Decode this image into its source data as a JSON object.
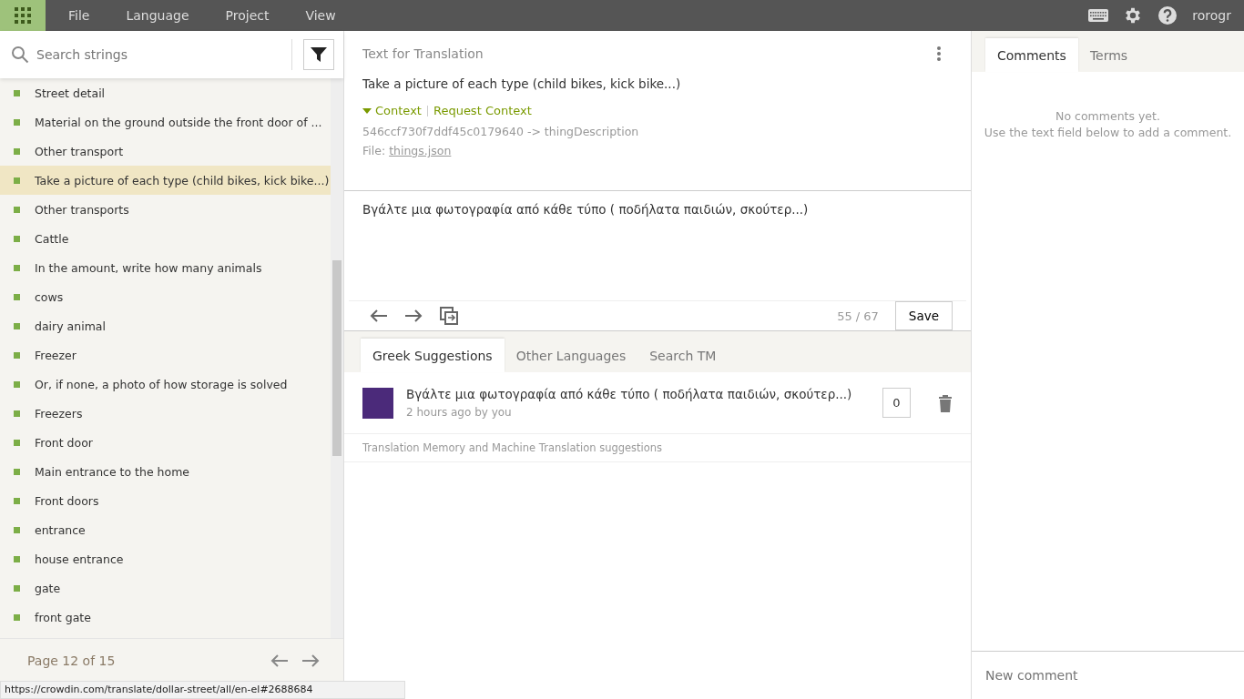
{
  "menu": [
    "File",
    "Language",
    "Project",
    "View"
  ],
  "user": "rorogr",
  "search": {
    "placeholder": "Search strings"
  },
  "strings": [
    {
      "text": "Street detail",
      "selected": false
    },
    {
      "text": "Material on the ground outside the front door of ...",
      "selected": false
    },
    {
      "text": "Other transport",
      "selected": false
    },
    {
      "text": "Take a picture of each type (child bikes, kick bike...)",
      "selected": true
    },
    {
      "text": "Other transports",
      "selected": false
    },
    {
      "text": "Cattle",
      "selected": false
    },
    {
      "text": "In the amount, write how many animals",
      "selected": false
    },
    {
      "text": "cows",
      "selected": false
    },
    {
      "text": "dairy animal",
      "selected": false
    },
    {
      "text": "Freezer",
      "selected": false
    },
    {
      "text": "Or, if none, a photo of how storage is solved",
      "selected": false
    },
    {
      "text": "Freezers",
      "selected": false
    },
    {
      "text": "Front door",
      "selected": false
    },
    {
      "text": "Main entrance to the home",
      "selected": false
    },
    {
      "text": "Front doors",
      "selected": false
    },
    {
      "text": "entrance",
      "selected": false
    },
    {
      "text": "house entrance",
      "selected": false
    },
    {
      "text": "gate",
      "selected": false
    },
    {
      "text": "front gate",
      "selected": false
    }
  ],
  "pager": {
    "label": "Page 12 of 15"
  },
  "status_url": "https://crowdin.com/translate/dollar-street/all/en-el#2688684",
  "source": {
    "heading": "Text for Translation",
    "text": "Take a picture of each type (child bikes, kick bike...)",
    "context_link": "Context",
    "request_link": "Request Context",
    "key": "546ccf730f7ddf45c0179640 -> thingDescription",
    "file_label": "File:",
    "file_name": "things.json"
  },
  "translation": {
    "value": "Βγάλτε μια φωτογραφία από κάθε τύπο ( ποδήλατα παιδιών, σκούτερ...)",
    "counter": "55 / 67",
    "save": "Save"
  },
  "suggestion_tabs": [
    {
      "label": "Greek Suggestions",
      "selected": true
    },
    {
      "label": "Other Languages",
      "selected": false
    },
    {
      "label": "Search TM",
      "selected": false
    }
  ],
  "suggestions": [
    {
      "text": "Βγάλτε μια φωτογραφία από κάθε τύπο ( ποδήλατα παιδιών, σκούτερ...)",
      "meta": "2 hours ago by you",
      "votes": "0"
    }
  ],
  "tm_note": "Translation Memory and Machine Translation suggestions",
  "side_tabs": [
    {
      "label": "Comments",
      "selected": true
    },
    {
      "label": "Terms",
      "selected": false
    }
  ],
  "comments_empty": [
    "No comments yet.",
    "Use the text field below to add a comment."
  ],
  "new_comment": {
    "placeholder": "New comment"
  }
}
